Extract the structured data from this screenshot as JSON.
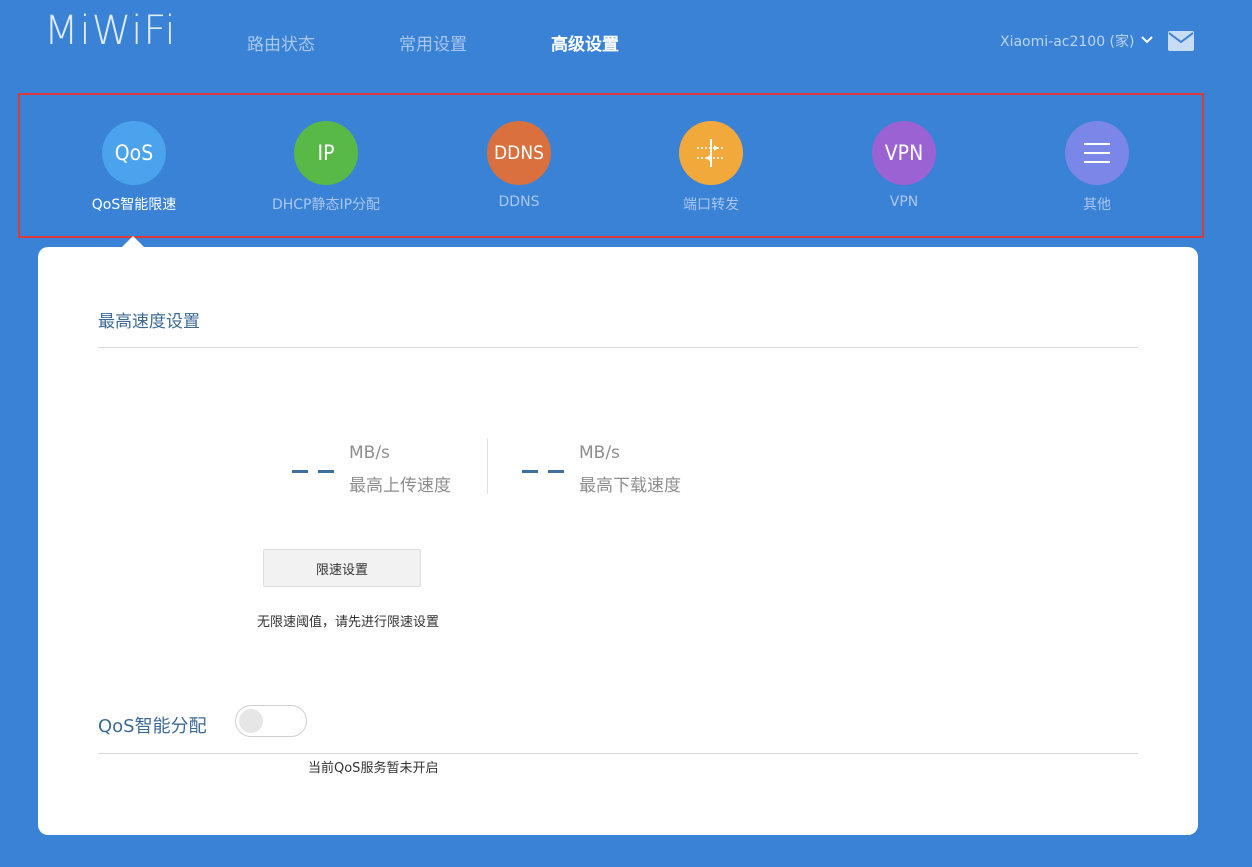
{
  "header": {
    "logo": "MiWiFi",
    "nav": [
      {
        "label": "路由状态",
        "active": false
      },
      {
        "label": "常用设置",
        "active": false
      },
      {
        "label": "高级设置",
        "active": true
      }
    ],
    "device_name": "Xiaomi-ac2100 (家)"
  },
  "apps": [
    {
      "icon_text": "QoS",
      "label": "QoS智能限速",
      "color": "#4aa3ec",
      "active": true
    },
    {
      "icon_text": "IP",
      "label": "DHCP静态IP分配",
      "color": "#58b947",
      "active": false
    },
    {
      "icon_text": "DDNS",
      "label": "DDNS",
      "color": "#d9703d",
      "active": false
    },
    {
      "icon_text": "",
      "icon": "port-forward-icon",
      "label": "端口转发",
      "color": "#f2a93b",
      "active": false
    },
    {
      "icon_text": "VPN",
      "label": "VPN",
      "color": "#9b62d4",
      "active": false
    },
    {
      "icon_text": "",
      "icon": "menu-icon",
      "label": "其他",
      "color": "#7b87e8",
      "active": false
    }
  ],
  "main": {
    "section_title": "最高速度设置",
    "upload": {
      "unit": "MB/s",
      "label": "最高上传速度"
    },
    "download": {
      "unit": "MB/s",
      "label": "最高下载速度"
    },
    "limit_button": "限速设置",
    "limit_hint": "无限速阈值，请先进行限速设置",
    "qos_title": "QoS智能分配",
    "qos_enabled": false,
    "qos_status": "当前QoS服务暂未开启"
  }
}
